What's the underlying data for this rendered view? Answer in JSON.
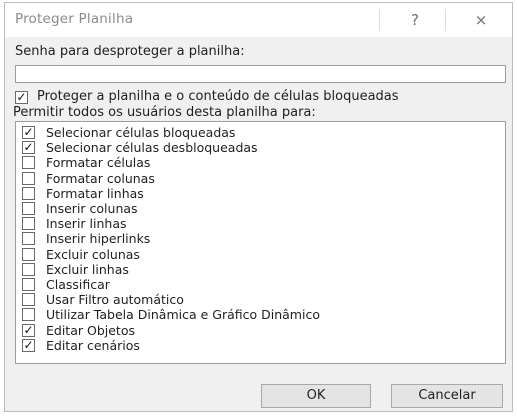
{
  "dialog": {
    "title": "Proteger Planilha",
    "help_label": "?",
    "close_label": "×"
  },
  "password": {
    "label": "Senha para desproteger a planilha:",
    "value": ""
  },
  "protect": {
    "checked": true,
    "label": "Proteger a planilha e o conteúdo de células bloqueadas"
  },
  "permissions": {
    "label": "Permitir todos os usuários desta planilha para:",
    "items": [
      {
        "label": "Selecionar células bloqueadas",
        "checked": true
      },
      {
        "label": "Selecionar células desbloqueadas",
        "checked": true
      },
      {
        "label": "Formatar células",
        "checked": false
      },
      {
        "label": "Formatar colunas",
        "checked": false
      },
      {
        "label": "Formatar linhas",
        "checked": false
      },
      {
        "label": "Inserir colunas",
        "checked": false
      },
      {
        "label": "Inserir linhas",
        "checked": false
      },
      {
        "label": "Inserir hiperlinks",
        "checked": false
      },
      {
        "label": "Excluir colunas",
        "checked": false
      },
      {
        "label": "Excluir linhas",
        "checked": false
      },
      {
        "label": "Classificar",
        "checked": false
      },
      {
        "label": "Usar Filtro automático",
        "checked": false
      },
      {
        "label": "Utilizar Tabela Dinâmica e Gráfico Dinâmico",
        "checked": false
      },
      {
        "label": "Editar Objetos",
        "checked": true
      },
      {
        "label": "Editar cenários",
        "checked": true
      }
    ]
  },
  "buttons": {
    "ok": "OK",
    "cancel": "Cancelar"
  }
}
